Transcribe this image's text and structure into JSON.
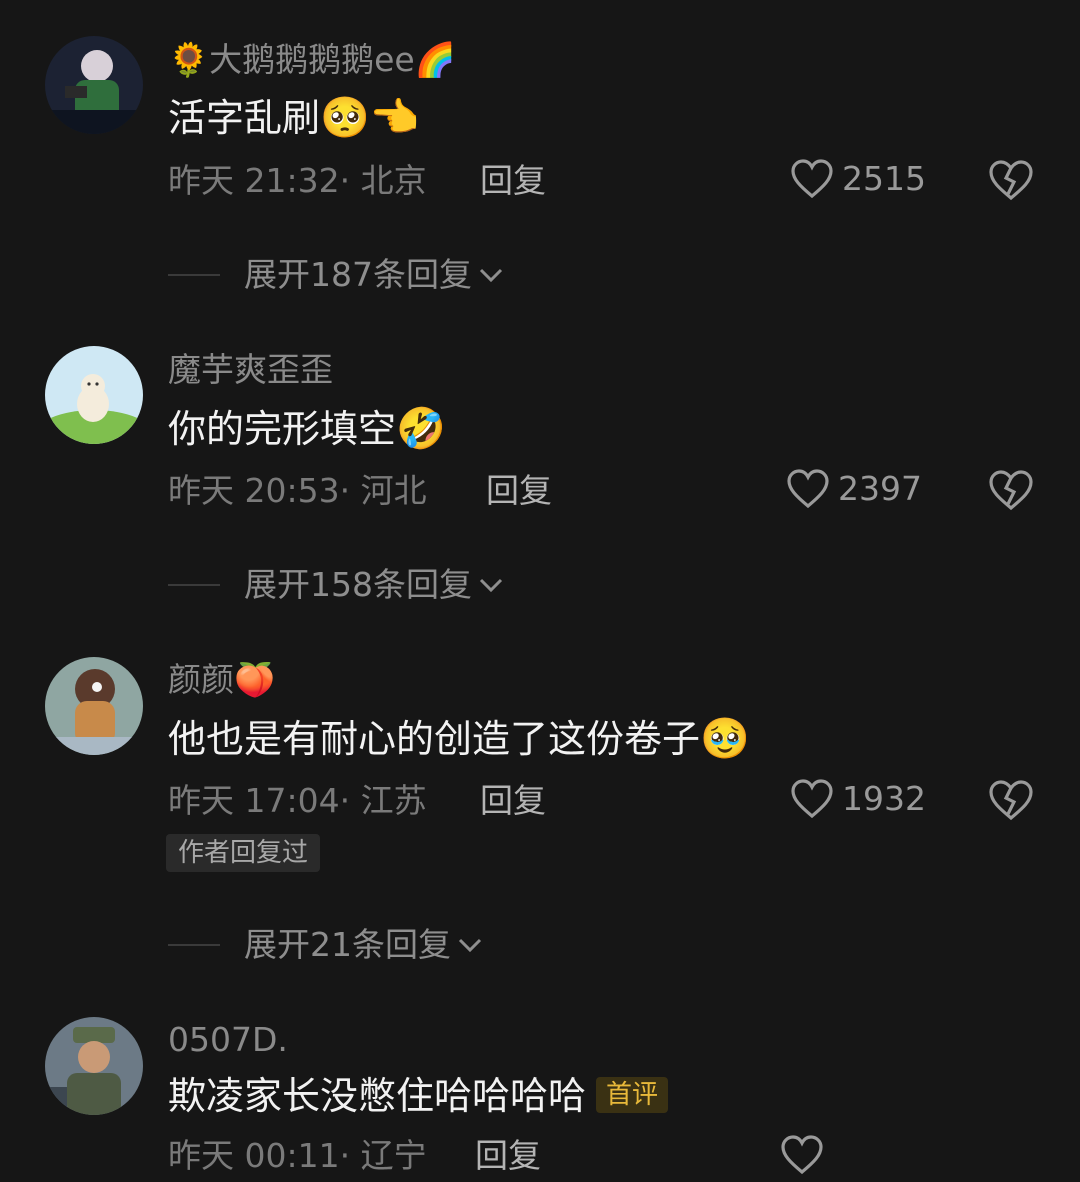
{
  "comments": [
    {
      "username": "🌻大鹅鹅鹅鹅ee🌈",
      "text": "活字乱刷",
      "text_emojis": "🥺👈",
      "meta": "昨天 21:32· 北京",
      "reply_label": "回复",
      "likes": "2515",
      "expand": "展开187条回复"
    },
    {
      "username": "魔芋爽歪歪",
      "text": "你的完形填空",
      "text_emojis": "🤣",
      "meta": "昨天 20:53· 河北",
      "reply_label": "回复",
      "likes": "2397",
      "expand": "展开158条回复"
    },
    {
      "username": "颜颜🍑",
      "text": "他也是有耐心的创造了这份卷子",
      "text_emojis": "🥹",
      "meta": "昨天 17:04· 江苏",
      "reply_label": "回复",
      "likes": "1932",
      "author_badge": "作者回复过",
      "expand": "展开21条回复"
    },
    {
      "username": "0507D.",
      "text": "欺凌家长没憋住哈哈哈哈",
      "first_badge": "首评",
      "meta": "昨天 00:11· 辽宁",
      "reply_label": "回复"
    }
  ],
  "colors": {
    "background": "#161616",
    "accent_badge": "#e8b93a"
  },
  "icons": [
    "heart-outline-icon",
    "broken-heart-icon",
    "chevron-down-icon"
  ]
}
